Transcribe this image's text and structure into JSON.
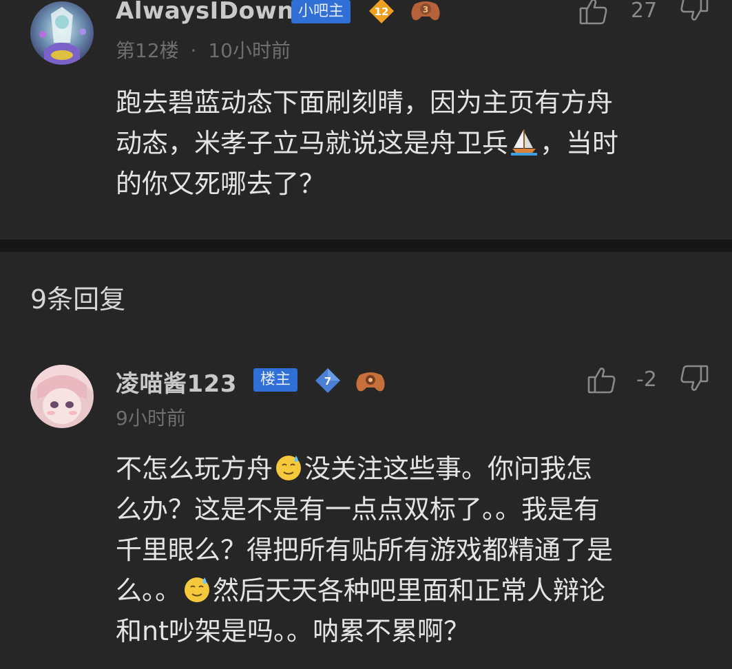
{
  "post": {
    "username": "AlwaysIDown",
    "role_badge": "小吧主",
    "level": "12",
    "game_level": "3",
    "floor": "第12楼",
    "separator": "·",
    "time": "10小时前",
    "likes": "27",
    "content_lines": [
      "跑去碧蓝动态下面刷刻晴，因为主页有方舟",
      [
        "动态，米孝子立马就说这是舟卫兵",
        "sailboat-emoji",
        "，当时"
      ],
      "的你又死哪去了？"
    ]
  },
  "replies": {
    "header": "9条回复",
    "items": [
      {
        "username": "凌喵酱123",
        "role_badge": "楼主",
        "level": "7",
        "time": "9小时前",
        "likes": "-2",
        "content_lines": [
          [
            "不怎么玩方舟",
            "sweat-smile-emoji",
            "没关注这些事。你问我怎"
          ],
          "么办？这是不是有一点点双标了。。我是有",
          "千里眼么？得把所有贴所有游戏都精通了是",
          [
            "么。。",
            "sweat-smile-emoji",
            "然后天天各种吧里面和正常人辩论"
          ],
          "和nt吵架是吗。。呐累不累啊？"
        ]
      }
    ]
  },
  "colors": {
    "background": "#262626",
    "divider": "#161616",
    "badge_blue": "#2f6fd6",
    "level_orange": "#f0a020",
    "level_blue": "#4a7fd6",
    "muted_text": "#6f6f6f"
  },
  "icons": [
    "thumb-up-icon",
    "thumb-down-icon",
    "level-badge-icon",
    "game-controller-icon"
  ]
}
